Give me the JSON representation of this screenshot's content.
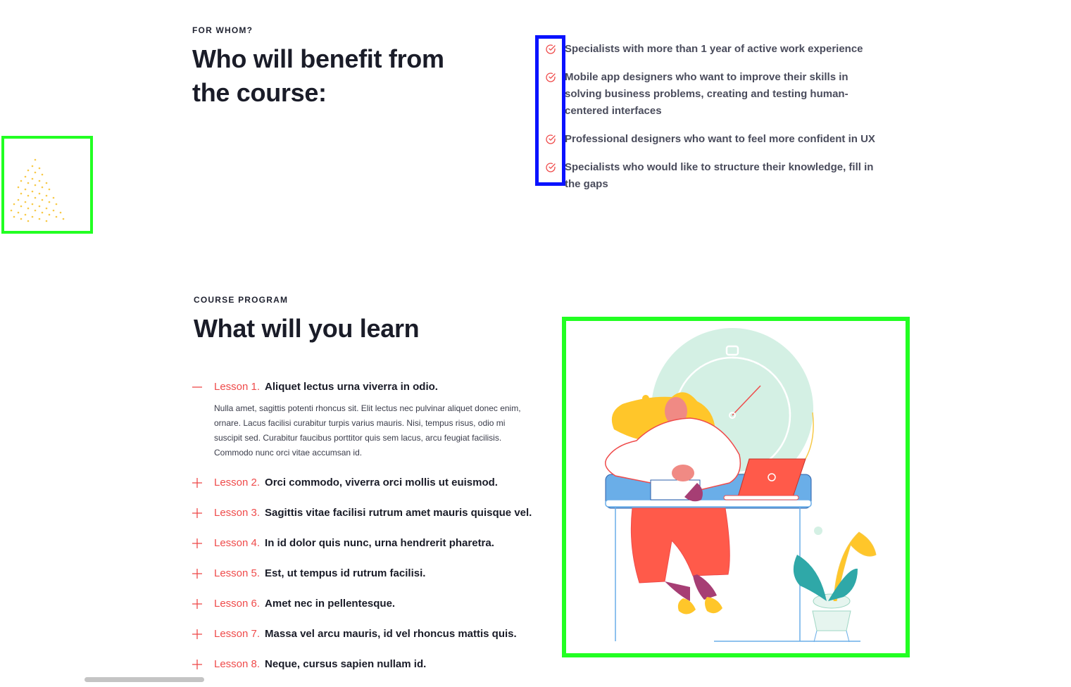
{
  "for_whom": {
    "eyebrow": "FOR WHOM?",
    "heading_line1": "Who will benefit from",
    "heading_line2": "the course:",
    "items": [
      {
        "text": "Specialists with more than 1 year of active work experience"
      },
      {
        "text": "Mobile app designers who want to improve their skills in solving business problems, creating and testing human-centered interfaces"
      },
      {
        "text": "Professional designers who want to feel more confident in UX"
      },
      {
        "text": "Specialists who would like to structure their knowledge, fill in the gaps"
      }
    ],
    "icon": "check-circle-icon"
  },
  "program": {
    "eyebrow": "COURSE PROGRAM",
    "heading": "What will you learn",
    "lessons": [
      {
        "number": "Lesson 1.",
        "title": "Aliquet lectus urna viverra in odio.",
        "expanded": true,
        "icon": "minus-icon",
        "body": "Nulla amet, sagittis potenti rhoncus sit. Elit lectus nec pulvinar aliquet donec enim, ornare. Lacus facilisi curabitur turpis varius mauris. Nisi, tempus risus, odio mi suscipit sed. Curabitur faucibus porttitor quis sem lacus, arcu feugiat facilisis. Commodo nunc orci vitae accumsan id."
      },
      {
        "number": "Lesson 2.",
        "title": "Orci commodo, viverra orci mollis ut euismod.",
        "expanded": false,
        "icon": "plus-icon"
      },
      {
        "number": "Lesson 3.",
        "title": "Sagittis vitae facilisi rutrum amet mauris quisque vel.",
        "expanded": false,
        "icon": "plus-icon"
      },
      {
        "number": "Lesson 4.",
        "title": "In id dolor quis nunc, urna hendrerit pharetra.",
        "expanded": false,
        "icon": "plus-icon"
      },
      {
        "number": "Lesson 5.",
        "title": "Est, ut tempus id rutrum facilisi.",
        "expanded": false,
        "icon": "plus-icon"
      },
      {
        "number": "Lesson 6.",
        "title": "Amet nec in pellentesque.",
        "expanded": false,
        "icon": "plus-icon"
      },
      {
        "number": "Lesson 7.",
        "title": "Massa vel arcu mauris, id vel rhoncus mattis quis.",
        "expanded": false,
        "icon": "plus-icon"
      },
      {
        "number": "Lesson 8.",
        "title": "Neque, cursus sapien nullam id.",
        "expanded": false,
        "icon": "plus-icon"
      }
    ]
  },
  "colors": {
    "accent_red": "#ef4b4b",
    "heading": "#1a1c28",
    "highlight_green": "#22ff22",
    "highlight_blue": "#0a12ff",
    "dots_yellow": "#f7c948"
  }
}
